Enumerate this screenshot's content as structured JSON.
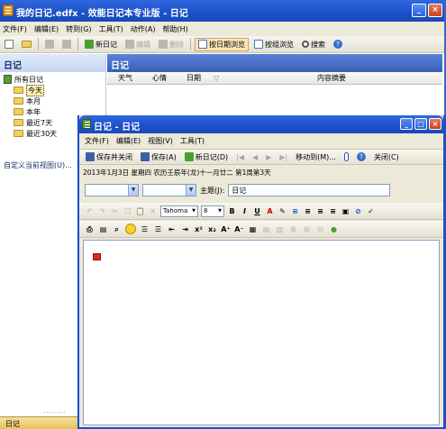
{
  "main_window": {
    "title": "我的日记.edfx - 效能日记本专业版 - 日记",
    "menu": [
      "文件(F)",
      "编辑(E)",
      "转到(G)",
      "工具(T)",
      "动作(A)",
      "帮助(H)"
    ],
    "toolbar": {
      "new_diary": "新日记",
      "edit": "编辑",
      "delete": "删除",
      "by_date": "按日期浏览",
      "by_group": "按组浏览",
      "search": "搜索"
    },
    "left_pane": {
      "header": "日记",
      "tree": {
        "root": "所有日记",
        "children": [
          "今天",
          "本月",
          "本年",
          "最近7天",
          "最近30天"
        ],
        "selected_index": 0
      },
      "custom_view": "自定义当前视图(U)...",
      "bottom_tab": "日记",
      "dots": "........"
    },
    "right_pane": {
      "header": "日记",
      "columns": [
        "天气",
        "心情",
        "日期",
        "▽",
        "内容摘要"
      ]
    }
  },
  "dialog": {
    "title": "日记 - 日记",
    "menu": [
      "文件(F)",
      "编辑(E)",
      "视图(V)",
      "工具(T)"
    ],
    "toolbar": {
      "save_close": "保存并关闭",
      "save": "保存(A)",
      "new_diary": "新日记(D)",
      "move_to": "移动到(M)...",
      "close": "关闭(C)"
    },
    "date_info": "2013年1月3日 星期四 农历壬辰年(龙)十一月廿二   第1周第3天",
    "subject_label": "主题(J):",
    "subject_value": "日记",
    "font_name": "Tahoma",
    "font_size": "8"
  },
  "colors": {
    "titlebar": "#1c4fc9",
    "chrome": "#ece9d8",
    "accent_red": "#e0261e"
  }
}
